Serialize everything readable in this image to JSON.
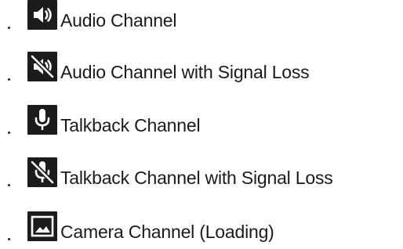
{
  "legend": {
    "items": [
      {
        "icon": "speaker-icon",
        "label": "Audio Channel"
      },
      {
        "icon": "speaker-muted-icon",
        "label": "Audio Channel with Signal Loss"
      },
      {
        "icon": "microphone-icon",
        "label": "Talkback Channel"
      },
      {
        "icon": "microphone-muted-icon",
        "label": "Talkback Channel with Signal Loss"
      },
      {
        "icon": "image-icon",
        "label": "Camera Channel (Loading)"
      }
    ]
  },
  "colors": {
    "icon_background": "#1c1c1c",
    "icon_foreground": "#ffffff",
    "text": "#1a1a1a"
  }
}
